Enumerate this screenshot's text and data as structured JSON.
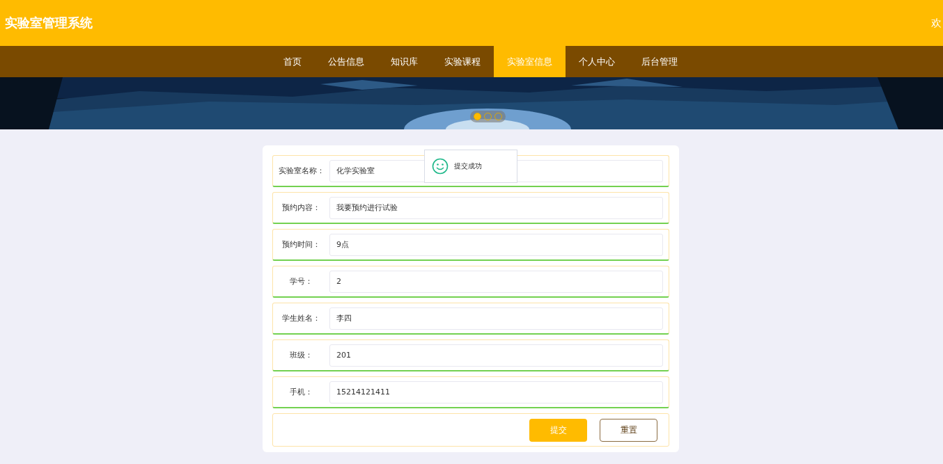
{
  "header": {
    "title": "实验室管理系统",
    "greeting": "欢"
  },
  "nav": [
    {
      "label": "首页",
      "selected": false
    },
    {
      "label": "公告信息",
      "selected": false
    },
    {
      "label": "知识库",
      "selected": false
    },
    {
      "label": "实验课程",
      "selected": false
    },
    {
      "label": "实验室信息",
      "selected": true
    },
    {
      "label": "个人中心",
      "selected": false
    },
    {
      "label": "后台管理",
      "selected": false
    }
  ],
  "banner": {
    "kind": "picture",
    "dots": [
      {
        "selected": true
      },
      {
        "selected": false
      },
      {
        "selected": false
      }
    ]
  },
  "form": {
    "fields": [
      {
        "label": "实验室名称：",
        "value": "化学实验室"
      },
      {
        "label": "预约内容：",
        "value": "我要预约进行试验"
      },
      {
        "label": "预约时间：",
        "value": "9点"
      },
      {
        "label": "学号：",
        "value": "2"
      },
      {
        "label": "学生姓名：",
        "value": "李四"
      },
      {
        "label": "班级：",
        "value": "201"
      },
      {
        "label": "手机：",
        "value": "15214121411"
      }
    ],
    "buttons": [
      {
        "label": "提交",
        "kind": "primary"
      },
      {
        "label": "重置",
        "kind": "secondary"
      }
    ]
  },
  "toast": {
    "message": "提交成功"
  }
}
